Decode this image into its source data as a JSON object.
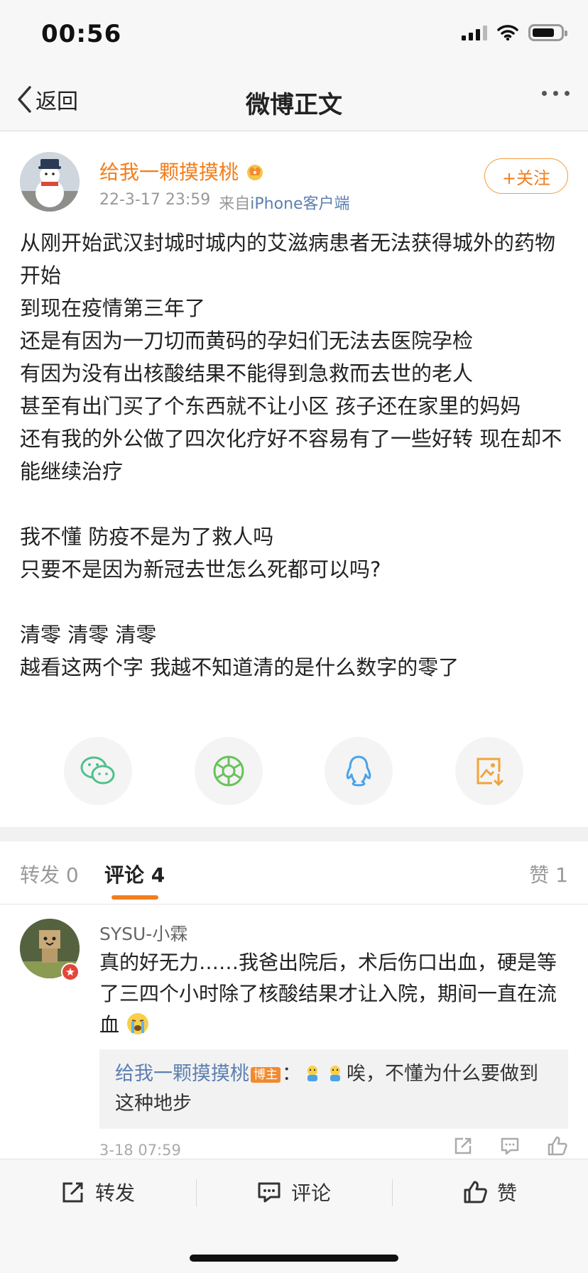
{
  "status_bar": {
    "time": "00:56",
    "signal_icon": "signal-icon",
    "wifi_icon": "wifi-icon",
    "battery_icon": "battery-icon",
    "battery_level": 0.7
  },
  "nav": {
    "back_label": "返回",
    "title": "微博正文",
    "more_icon": "more-dots-icon"
  },
  "post": {
    "author": "给我一颗摸摸桃",
    "date": "22-3-17 23:59",
    "source_prefix": "来自",
    "source": "iPhone客户端",
    "follow_label": "+关注",
    "body": [
      "从刚开始武汉封城时城内的艾滋病患者无法获得城外的药物开始",
      "到现在疫情第三年了",
      "还是有因为一刀切而黄码的孕妇们无法去医院孕检",
      "有因为没有出核酸结果不能得到急救而去世的老人",
      "甚至有出门买了个东西就不让小区 孩子还在家里的妈妈",
      "还有我的外公做了四次化疗好不容易有了一些好转 现在却不能继续治疗",
      "",
      "我不懂 防疫不是为了救人吗",
      "只要不是因为新冠去世怎么死都可以吗?",
      "",
      "清零 清零 清零",
      "越看这两个字 我越不知道清的是什么数字的零了"
    ]
  },
  "share": [
    "wechat-icon",
    "moments-icon",
    "qq-icon",
    "save-image-icon"
  ],
  "tabs": {
    "repost": "转发 0",
    "comment": "评论 4",
    "like": "赞 1"
  },
  "comment": {
    "name": "SYSU-小霖",
    "text": "真的好无力……我爸出院后，术后伤口出血，硬是等了三四个小时除了核酸结果才让入院，期间一直在流血",
    "reply_author": "给我一颗摸摸桃",
    "host_tag": "博主",
    "reply_sep": "：",
    "reply_text": "唉，不懂为什么要做到这种地步",
    "time": "3-18 07:59"
  },
  "bottom_bar": {
    "repost": "转发",
    "comment": "评论",
    "like": "赞"
  },
  "colors": {
    "accent": "#f27e1d",
    "link": "#5d7fb1",
    "wechat": "#4fc08d",
    "moments": "#68c25a",
    "qq": "#4aa3e8",
    "save": "#f2a33a"
  }
}
